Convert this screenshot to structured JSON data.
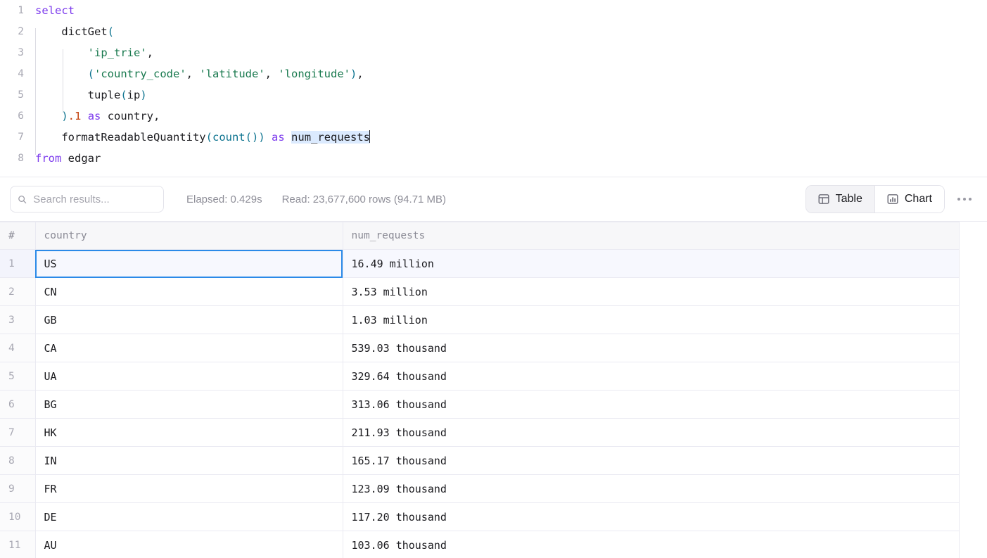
{
  "editor": {
    "lines": [
      {
        "n": "1",
        "tokens": [
          {
            "t": "select",
            "c": "kw"
          }
        ]
      },
      {
        "n": "2",
        "tokens": [
          {
            "t": "    ",
            "c": ""
          },
          {
            "t": "dictGet",
            "c": ""
          },
          {
            "t": "(",
            "c": "punc"
          }
        ]
      },
      {
        "n": "3",
        "tokens": [
          {
            "t": "        ",
            "c": ""
          },
          {
            "t": "'ip_trie'",
            "c": "str"
          },
          {
            "t": ",",
            "c": ""
          }
        ]
      },
      {
        "n": "4",
        "tokens": [
          {
            "t": "        ",
            "c": ""
          },
          {
            "t": "(",
            "c": "punc"
          },
          {
            "t": "'country_code'",
            "c": "str"
          },
          {
            "t": ", ",
            "c": ""
          },
          {
            "t": "'latitude'",
            "c": "str"
          },
          {
            "t": ", ",
            "c": ""
          },
          {
            "t": "'longitude'",
            "c": "str"
          },
          {
            "t": ")",
            "c": "punc"
          },
          {
            "t": ",",
            "c": ""
          }
        ]
      },
      {
        "n": "5",
        "tokens": [
          {
            "t": "        ",
            "c": ""
          },
          {
            "t": "tuple",
            "c": ""
          },
          {
            "t": "(",
            "c": "punc"
          },
          {
            "t": "ip",
            "c": ""
          },
          {
            "t": ")",
            "c": "punc"
          }
        ]
      },
      {
        "n": "6",
        "tokens": [
          {
            "t": "    ",
            "c": ""
          },
          {
            "t": ")",
            "c": "punc"
          },
          {
            "t": ".1",
            "c": "num"
          },
          {
            "t": " ",
            "c": ""
          },
          {
            "t": "as",
            "c": "kw"
          },
          {
            "t": " country,",
            "c": ""
          }
        ]
      },
      {
        "n": "7",
        "tokens": [
          {
            "t": "    ",
            "c": ""
          },
          {
            "t": "formatReadableQuantity",
            "c": ""
          },
          {
            "t": "(",
            "c": "punc"
          },
          {
            "t": "count",
            "c": "fn"
          },
          {
            "t": "()",
            "c": "punc"
          },
          {
            "t": ")",
            "c": "punc"
          },
          {
            "t": " ",
            "c": ""
          },
          {
            "t": "as",
            "c": "kw"
          },
          {
            "t": " ",
            "c": ""
          },
          {
            "t": "num_requests",
            "c": "sel"
          }
        ]
      },
      {
        "n": "8",
        "tokens": [
          {
            "t": "from",
            "c": "kw"
          },
          {
            "t": " edgar",
            "c": ""
          }
        ]
      }
    ]
  },
  "toolbar": {
    "search_placeholder": "Search results...",
    "search_value": "",
    "elapsed": "Elapsed: 0.429s",
    "read": "Read: 23,677,600 rows (94.71 MB)",
    "view_modes": [
      {
        "label": "Table",
        "icon": "table-icon",
        "active": true
      },
      {
        "label": "Chart",
        "icon": "bar-chart-icon",
        "active": false
      }
    ],
    "more_label": "More options"
  },
  "results": {
    "columns": [
      "#",
      "country",
      "num_requests"
    ],
    "rows": [
      {
        "n": "1",
        "country": "US",
        "num_requests": "16.49 million"
      },
      {
        "n": "2",
        "country": "CN",
        "num_requests": "3.53 million"
      },
      {
        "n": "3",
        "country": "GB",
        "num_requests": "1.03 million"
      },
      {
        "n": "4",
        "country": "CA",
        "num_requests": "539.03 thousand"
      },
      {
        "n": "5",
        "country": "UA",
        "num_requests": "329.64 thousand"
      },
      {
        "n": "6",
        "country": "BG",
        "num_requests": "313.06 thousand"
      },
      {
        "n": "7",
        "country": "HK",
        "num_requests": "211.93 thousand"
      },
      {
        "n": "8",
        "country": "IN",
        "num_requests": "165.17 thousand"
      },
      {
        "n": "9",
        "country": "FR",
        "num_requests": "123.09 thousand"
      },
      {
        "n": "10",
        "country": "DE",
        "num_requests": "117.20 thousand"
      },
      {
        "n": "11",
        "country": "AU",
        "num_requests": "103.06 thousand"
      }
    ],
    "selected_row": 0,
    "selected_column": 1
  },
  "colors": {
    "accent": "#2b8ae8",
    "keyword": "#7c3aed",
    "string": "#18794e",
    "function": "#0e7490",
    "number": "#c2410c",
    "selection": "#dbeafe"
  }
}
